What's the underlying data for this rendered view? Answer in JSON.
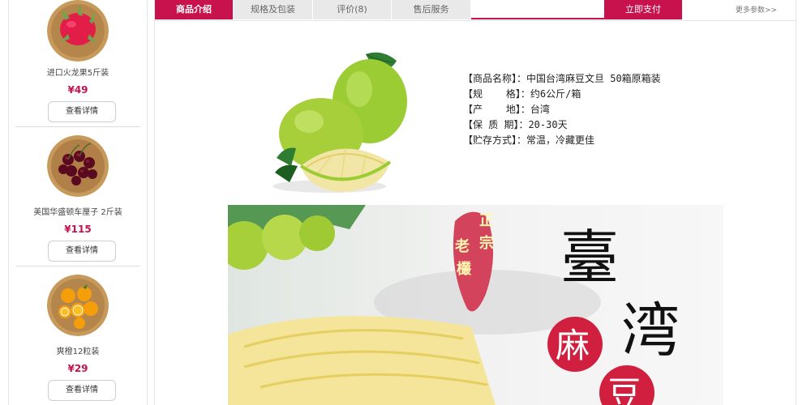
{
  "sidebar": {
    "products": [
      {
        "name": "进口火龙果5斤装",
        "price": "¥49",
        "button": "查看详情",
        "image": "dragonfruit-image"
      },
      {
        "name": "美国华盛顿车厘子 2斤装",
        "price": "¥115",
        "button": "查看详情",
        "image": "cherries-image"
      },
      {
        "name": "爽橙12粒装",
        "price": "¥29",
        "button": "查看详情",
        "image": "oranges-image"
      }
    ]
  },
  "tabs": [
    {
      "label": "商品介绍",
      "active": true
    },
    {
      "label": "规格及包装",
      "active": false
    },
    {
      "label": "评价(8)",
      "active": false
    },
    {
      "label": "售后服务",
      "active": false
    }
  ],
  "buy_now": "立即支付",
  "more_params": "更多参数>>",
  "specs": [
    "【商品名称】：中国台湾麻豆文旦 50箱原箱装",
    "【规    格】：约6公斤/箱",
    "【产    地】：台湾",
    "【保 质 期】：20-30天",
    "【贮存方式】：常温，冷藏更佳"
  ],
  "banner": {
    "seal_text": [
      "正",
      "宗",
      "老",
      "欉"
    ],
    "title_chars": [
      "臺",
      "湾"
    ],
    "circle_chars": [
      "麻",
      "豆"
    ]
  },
  "colors": {
    "accent": "#c8124d",
    "price": "#c2134c",
    "tab_inactive": "#e9e9e9"
  }
}
